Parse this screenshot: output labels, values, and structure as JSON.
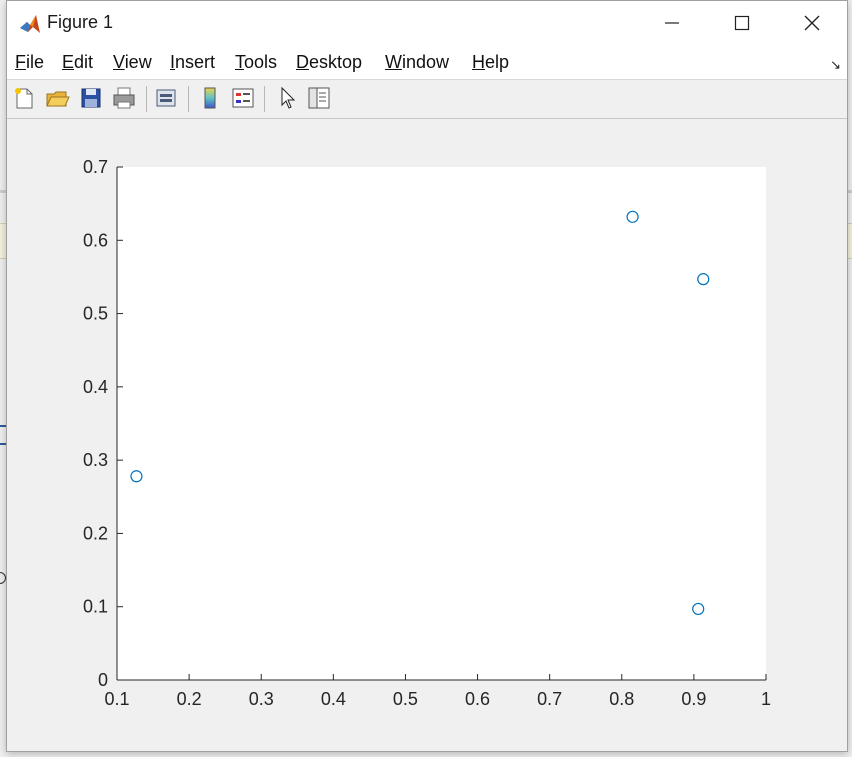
{
  "window": {
    "title": "Figure 1"
  },
  "menu": {
    "items": [
      "File",
      "Edit",
      "View",
      "Insert",
      "Tools",
      "Desktop",
      "Window",
      "Help"
    ]
  },
  "toolbar": {
    "icons": [
      "new-figure-icon",
      "open-file-icon",
      "save-icon",
      "print-icon",
      "link-plot-icon",
      "insert-colorbar-icon",
      "insert-legend-icon",
      "edit-plot-icon",
      "property-inspector-icon"
    ]
  },
  "colors": {
    "marker": "#0072BD",
    "axes_bg": "#ffffff",
    "figure_bg": "#f0f0f0"
  },
  "chart_data": {
    "type": "scatter",
    "title": "",
    "xlabel": "",
    "ylabel": "",
    "xlim": [
      0.1,
      1
    ],
    "ylim": [
      0,
      0.7
    ],
    "xticks": [
      0.1,
      0.2,
      0.3,
      0.4,
      0.5,
      0.6,
      0.7,
      0.8,
      0.9,
      1
    ],
    "yticks": [
      0,
      0.1,
      0.2,
      0.3,
      0.4,
      0.5,
      0.6,
      0.7
    ],
    "xtick_labels": [
      "0.1",
      "0.2",
      "0.3",
      "0.4",
      "0.5",
      "0.6",
      "0.7",
      "0.8",
      "0.9",
      "1"
    ],
    "ytick_labels": [
      "0",
      "0.1",
      "0.2",
      "0.3",
      "0.4",
      "0.5",
      "0.6",
      "0.7"
    ],
    "grid": false,
    "marker": "circle",
    "points": [
      {
        "x": 0.127,
        "y": 0.278
      },
      {
        "x": 0.815,
        "y": 0.632
      },
      {
        "x": 0.913,
        "y": 0.547
      },
      {
        "x": 0.906,
        "y": 0.097
      }
    ]
  }
}
